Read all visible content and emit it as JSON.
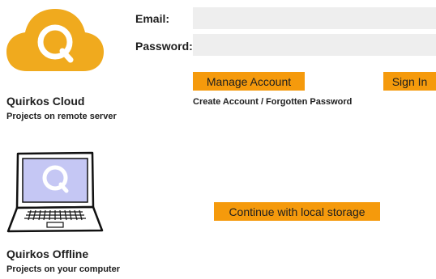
{
  "cloud": {
    "title": "Quirkos Cloud",
    "subtitle": "Projects on remote server",
    "icon": "cloud-logo-icon"
  },
  "offline": {
    "title": "Quirkos Offline",
    "subtitle": "Projects on your computer",
    "icon": "laptop-logo-icon"
  },
  "form": {
    "email_label": "Email:",
    "email_value": "",
    "password_label": "Password:",
    "password_value": ""
  },
  "buttons": {
    "manage_account": "Manage Account",
    "sign_in": "Sign In",
    "local_storage": "Continue with local storage"
  },
  "links": {
    "create_account": "Create Account / Forgotten Password"
  },
  "colors": {
    "accent": "#f59a0c",
    "logo": "#f0aa1e",
    "screen": "#c5c7f4",
    "input_bg": "#eeeeee"
  }
}
